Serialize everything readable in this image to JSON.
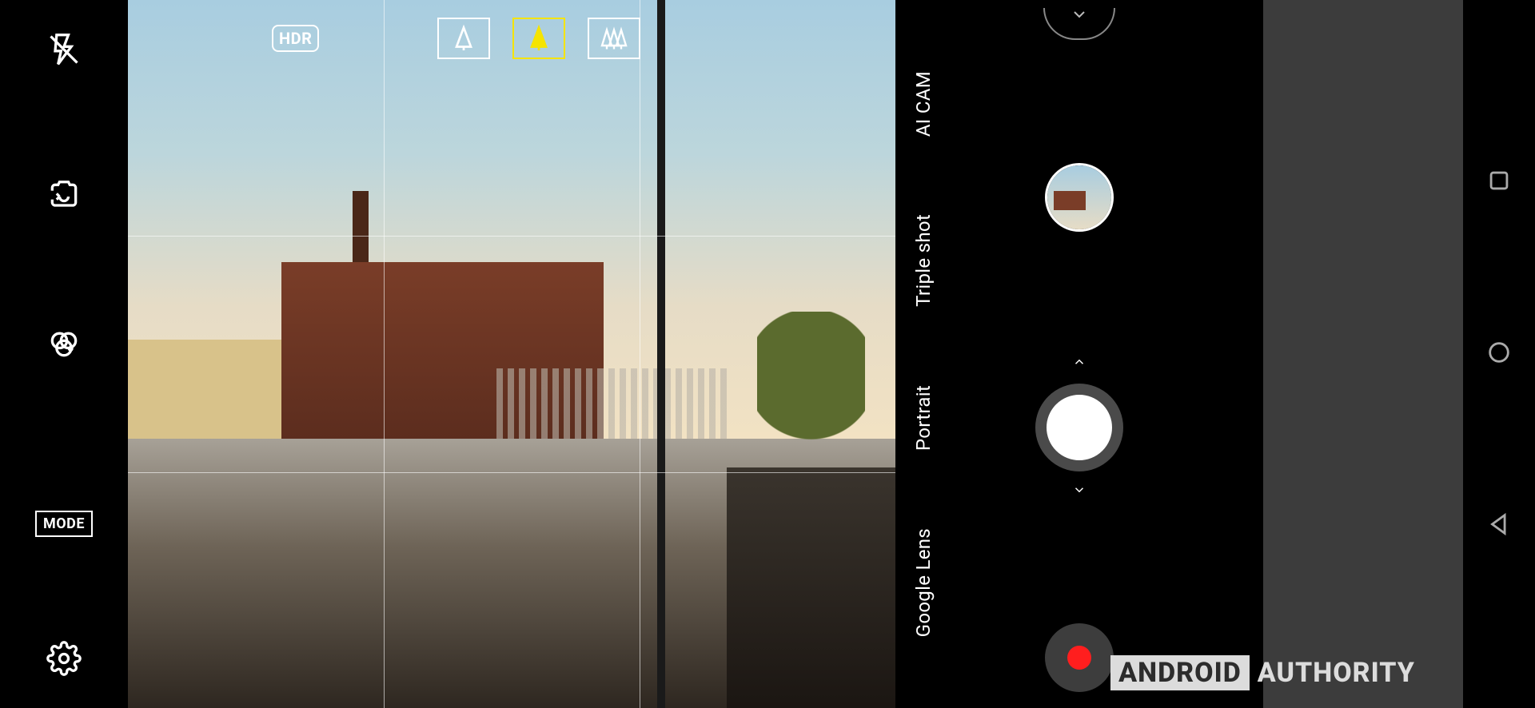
{
  "left_rail": {
    "flash": "flash-off-icon",
    "switch": "camera-switch-icon",
    "filters": "filters-icon",
    "mode_label": "MODE",
    "settings": "settings-icon"
  },
  "viewfinder_top": {
    "hdr_label": "HDR",
    "lenses": [
      {
        "name": "telephoto-lens",
        "active": false
      },
      {
        "name": "standard-lens",
        "active": true
      },
      {
        "name": "wide-lens",
        "active": false
      }
    ]
  },
  "modes": [
    "AI CAM",
    "Triple shot",
    "Portrait",
    "Google Lens"
  ],
  "shutter": {
    "peek": "chevron-down-icon",
    "thumb": "gallery-thumbnail",
    "prev": "chevron-up-icon",
    "next": "chevron-down-icon",
    "shutter": "shutter-button",
    "record": "record-button"
  },
  "nav": {
    "recents": "recents-icon",
    "home": "home-icon",
    "back": "back-icon"
  },
  "watermark": {
    "brand_box": "ANDROID",
    "brand_plain": "AUTHORITY"
  }
}
